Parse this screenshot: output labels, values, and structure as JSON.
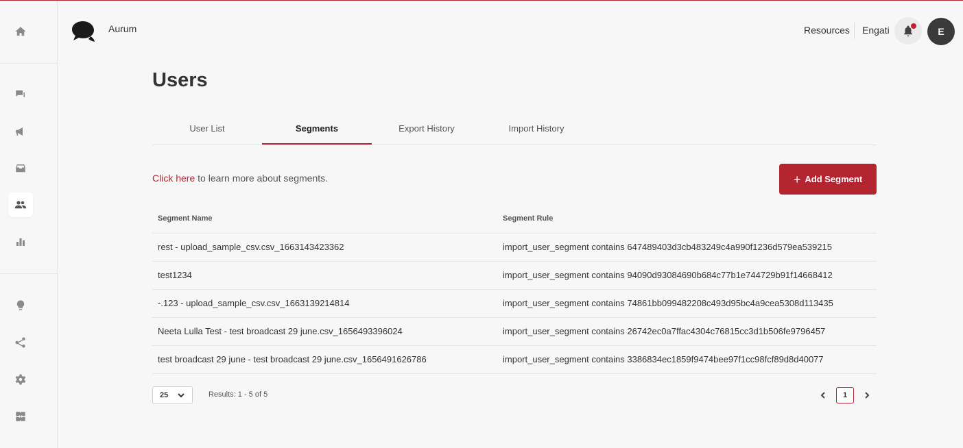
{
  "app": {
    "brand": "Aurum"
  },
  "header": {
    "resources_label": "Resources",
    "workspace_label": "Engati",
    "avatar_initial": "E"
  },
  "sidebar": {
    "items": [
      {
        "icon": "home-icon"
      },
      {
        "icon": "chat-icon"
      },
      {
        "icon": "megaphone-icon"
      },
      {
        "icon": "inbox-icon"
      },
      {
        "icon": "users-icon",
        "active": true
      },
      {
        "icon": "analytics-icon"
      },
      {
        "icon": "bulb-icon"
      },
      {
        "icon": "integrations-icon"
      },
      {
        "icon": "settings-icon"
      },
      {
        "icon": "marketplace-icon"
      }
    ]
  },
  "page": {
    "title": "Users"
  },
  "tabs": [
    {
      "label": "User List"
    },
    {
      "label": "Segments",
      "active": true
    },
    {
      "label": "Export History"
    },
    {
      "label": "Import History"
    }
  ],
  "info": {
    "link_text": "Click here",
    "rest_text": " to learn more about segments."
  },
  "add_button": {
    "label": "Add Segment"
  },
  "table": {
    "headers": [
      "Segment Name",
      "Segment Rule"
    ],
    "rows": [
      [
        "rest - upload_sample_csv.csv_1663143423362",
        "import_user_segment contains 647489403d3cb483249c4a990f1236d579ea539215"
      ],
      [
        "test1234",
        "import_user_segment contains 94090d93084690b684c77b1e744729b91f14668412"
      ],
      [
        "-.123 - upload_sample_csv.csv_1663139214814",
        "import_user_segment contains 74861bb099482208c493d95bc4a9cea5308d113435"
      ],
      [
        "Neeta Lulla Test - test broadcast 29 june.csv_1656493396024",
        "import_user_segment contains 26742ec0a7ffac4304c76815cc3d1b506fe9796457"
      ],
      [
        "test broadcast 29 june - test broadcast 29 june.csv_1656491626786",
        "import_user_segment contains 3386834ec1859f9474bee97f1cc98fcf89d8d40077"
      ]
    ]
  },
  "pagination": {
    "per_page": "25",
    "results": "Results: 1 - 5 of 5",
    "current_page": "1"
  },
  "colors": {
    "accent": "#b3262f",
    "avatar_bg": "#3a3a3a"
  }
}
